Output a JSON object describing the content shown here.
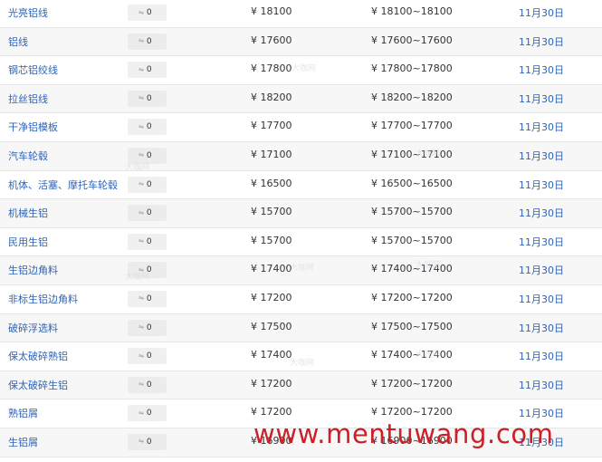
{
  "table": {
    "currency": "¥",
    "range_separator": "~",
    "rows": [
      {
        "name": "光亮铝线",
        "change": "0",
        "price": "18100",
        "low": "18100",
        "high": "18100",
        "date": "11月30日"
      },
      {
        "name": "铝线",
        "change": "0",
        "price": "17600",
        "low": "17600",
        "high": "17600",
        "date": "11月30日"
      },
      {
        "name": "钢芯铝绞线",
        "change": "0",
        "price": "17800",
        "low": "17800",
        "high": "17800",
        "date": "11月30日"
      },
      {
        "name": "拉丝铝线",
        "change": "0",
        "price": "18200",
        "low": "18200",
        "high": "18200",
        "date": "11月30日"
      },
      {
        "name": "干净铝模板",
        "change": "0",
        "price": "17700",
        "low": "17700",
        "high": "17700",
        "date": "11月30日"
      },
      {
        "name": "汽车轮毂",
        "change": "0",
        "price": "17100",
        "low": "17100",
        "high": "17100",
        "date": "11月30日"
      },
      {
        "name": "机体、活塞、摩托车轮毂",
        "change": "0",
        "price": "16500",
        "low": "16500",
        "high": "16500",
        "date": "11月30日"
      },
      {
        "name": "机械生铝",
        "change": "0",
        "price": "15700",
        "low": "15700",
        "high": "15700",
        "date": "11月30日"
      },
      {
        "name": "民用生铝",
        "change": "0",
        "price": "15700",
        "low": "15700",
        "high": "15700",
        "date": "11月30日"
      },
      {
        "name": "生铝边角料",
        "change": "0",
        "price": "17400",
        "low": "17400",
        "high": "17400",
        "date": "11月30日"
      },
      {
        "name": "非标生铝边角料",
        "change": "0",
        "price": "17200",
        "low": "17200",
        "high": "17200",
        "date": "11月30日"
      },
      {
        "name": "破碎浮选料",
        "change": "0",
        "price": "17500",
        "low": "17500",
        "high": "17500",
        "date": "11月30日"
      },
      {
        "name": "保太破碎熟铝",
        "change": "0",
        "price": "17400",
        "low": "17400",
        "high": "17400",
        "date": "11月30日"
      },
      {
        "name": "保太破碎生铝",
        "change": "0",
        "price": "17200",
        "low": "17200",
        "high": "17200",
        "date": "11月30日"
      },
      {
        "name": "熟铝屑",
        "change": "0",
        "price": "17200",
        "low": "17200",
        "high": "17200",
        "date": "11月30日"
      },
      {
        "name": "生铝屑",
        "change": "0",
        "price": "16900",
        "low": "16900",
        "high": "16900",
        "date": "11月30日"
      }
    ]
  },
  "icons": {
    "change": "trend-icon"
  },
  "colors": {
    "link": "#2f64b7",
    "text": "#333333",
    "watermark": "#cc1f26"
  },
  "watermark": {
    "site": "www.mentuwang.com",
    "logo": "大咖网"
  }
}
